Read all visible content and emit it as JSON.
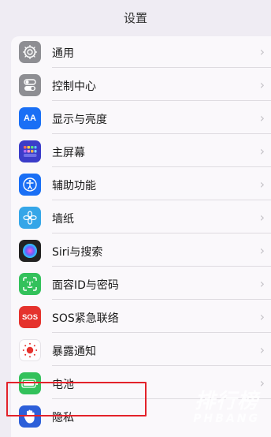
{
  "nav": {
    "title": "设置"
  },
  "rows": [
    {
      "label": "通用",
      "icon": "gear-icon",
      "color": "#8e8e93"
    },
    {
      "label": "控制中心",
      "icon": "toggle-icon",
      "color": "#8e8e93"
    },
    {
      "label": "显示与亮度",
      "icon": "text-size-icon",
      "color": "#1a6ff5",
      "icon_text": "AA"
    },
    {
      "label": "主屏幕",
      "icon": "app-grid-icon",
      "color": "#3b3cc9"
    },
    {
      "label": "辅助功能",
      "icon": "accessibility-icon",
      "color": "#1a6ff5"
    },
    {
      "label": "墙纸",
      "icon": "flower-icon",
      "color": "#35a6e8"
    },
    {
      "label": "Siri与搜索",
      "icon": "siri-icon",
      "color": "#222"
    },
    {
      "label": "面容ID与密码",
      "icon": "face-id-icon",
      "color": "#33c15b"
    },
    {
      "label": "SOS紧急联络",
      "icon": "sos-icon",
      "color": "#e5322d",
      "icon_text": "SOS"
    },
    {
      "label": "暴露通知",
      "icon": "exposure-icon",
      "color": "#ffffff"
    },
    {
      "label": "电池",
      "icon": "battery-icon",
      "color": "#33c15b"
    },
    {
      "label": "隐私",
      "icon": "hand-icon",
      "color": "#2d5fd9"
    }
  ],
  "watermark": {
    "main": "排行榜",
    "sub": "PHBANG"
  },
  "colors": {
    "highlight": "#e3222a",
    "background": "#efecf3"
  }
}
